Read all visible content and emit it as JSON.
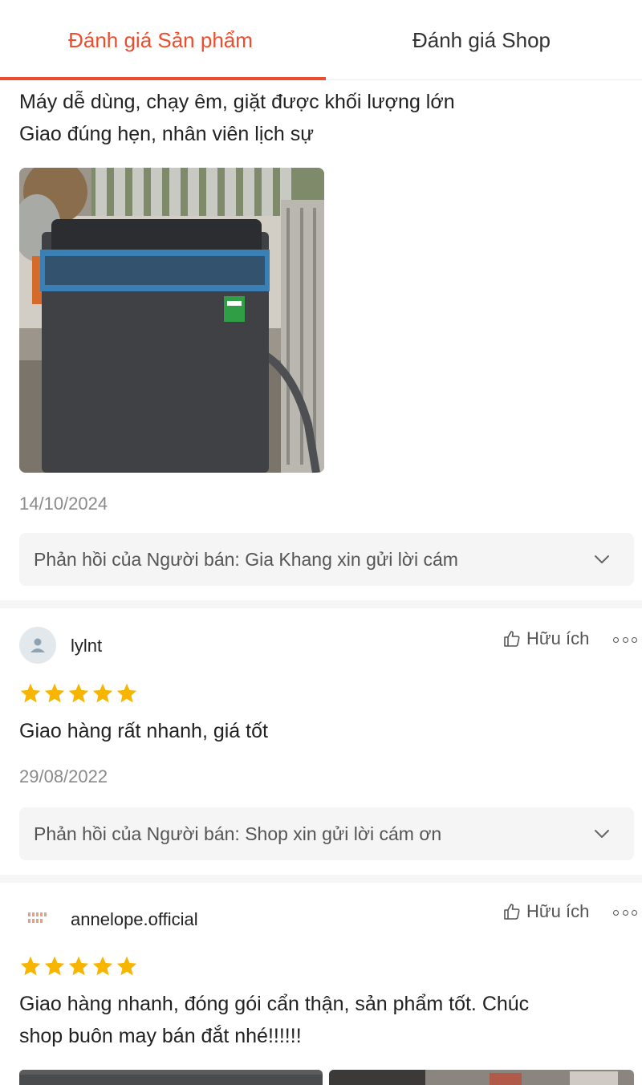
{
  "tabs": {
    "product_reviews": "Đánh giá Sản phẩm",
    "shop_reviews": "Đánh giá Shop"
  },
  "colors": {
    "accent": "#ee4d2d",
    "star": "#f7b500",
    "reply_bg": "#f5f5f5"
  },
  "reviews": [
    {
      "comment_lines": [
        "Máy dễ dùng, chạy êm, giặt được khối lượng lớn",
        "Giao đúng hẹn, nhân viên lịch sự"
      ],
      "photo": "washing-machine-photo",
      "date": "14/10/2024",
      "seller_reply": "Phản hồi của Người bán: Gia Khang xin gửi lời cám"
    },
    {
      "username": "lylnt",
      "helpful_label": "Hữu ích",
      "rating": 5,
      "comment_lines": [
        "Giao hàng rất nhanh, giá tốt"
      ],
      "date": "29/08/2022",
      "seller_reply": "Phản hồi của Người bán: Shop xin gửi lời cám ơn"
    },
    {
      "username": "annelope.official",
      "helpful_label": "Hữu ích",
      "rating": 5,
      "comment_lines": [
        "Giao hàng nhanh, đóng gói cẩn thận, sản phẩm tốt. Chúc",
        "shop buôn may bán đắt nhé!!!!!!"
      ]
    }
  ]
}
